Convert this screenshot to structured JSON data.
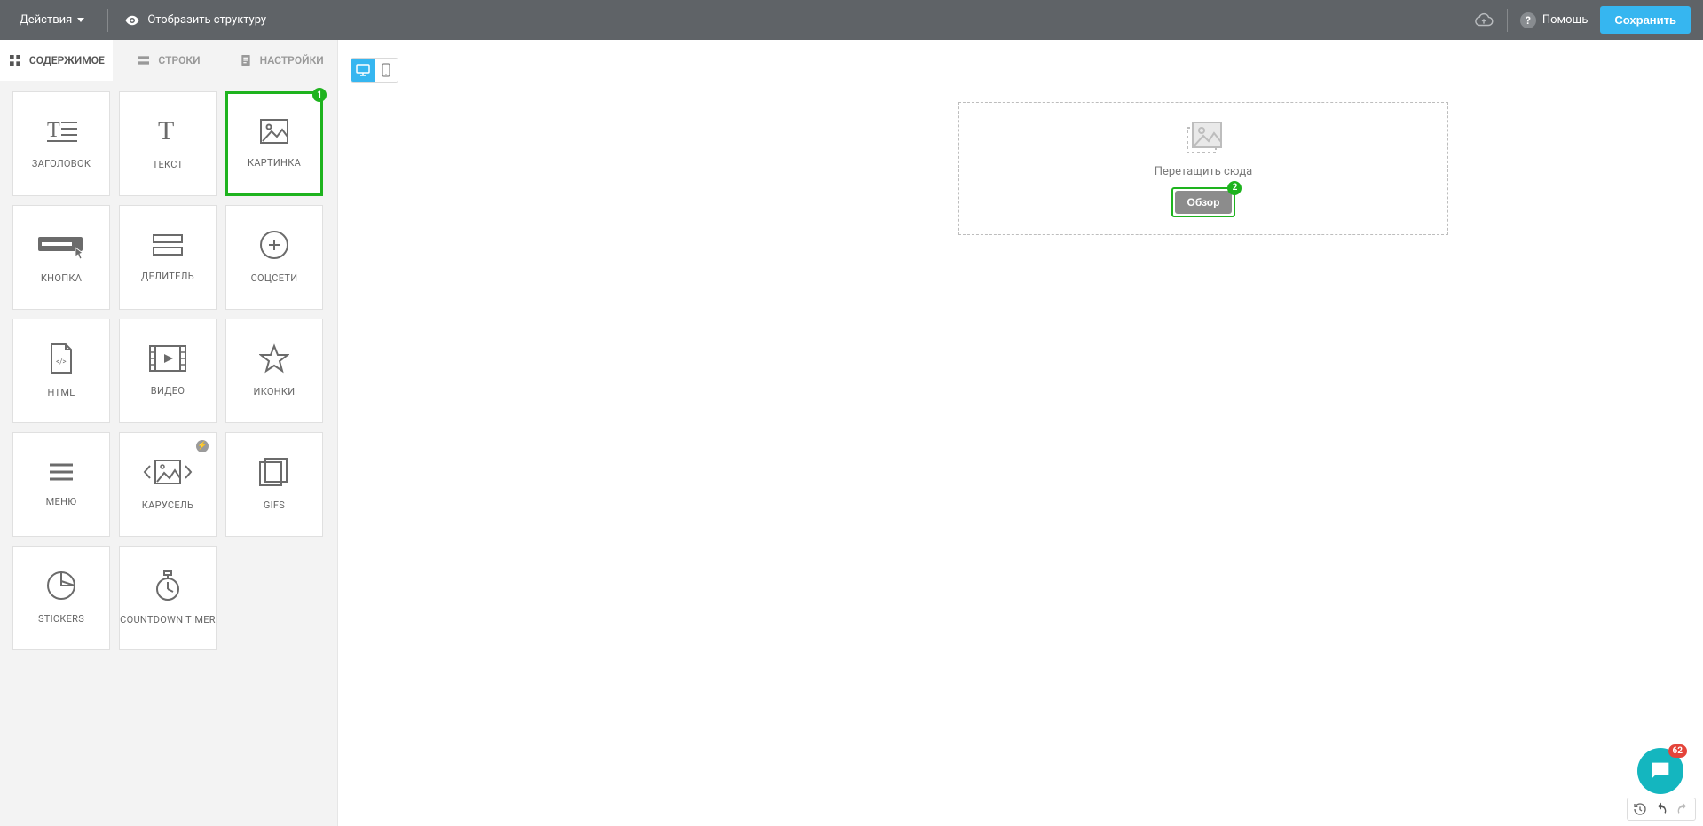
{
  "topbar": {
    "actions_label": "Действия",
    "show_structure_label": "Отобразить структуру",
    "help_label": "Помощь",
    "save_label": "Сохранить"
  },
  "tabs": {
    "content": "СОДЕРЖИМОЕ",
    "rows": "СТРОКИ",
    "settings": "НАСТРОЙКИ"
  },
  "tiles": [
    {
      "label": "ЗАГОЛОВОК",
      "icon": "heading",
      "highlighted": false
    },
    {
      "label": "ТЕКСТ",
      "icon": "text",
      "highlighted": false
    },
    {
      "label": "КАРТИНКА",
      "icon": "image",
      "highlighted": true,
      "step": "1"
    },
    {
      "label": "КНОПКА",
      "icon": "button",
      "highlighted": false
    },
    {
      "label": "ДЕЛИТЕЛЬ",
      "icon": "divider",
      "highlighted": false
    },
    {
      "label": "СОЦСЕТИ",
      "icon": "social",
      "highlighted": false
    },
    {
      "label": "HTML",
      "icon": "html",
      "highlighted": false
    },
    {
      "label": "ВИДЕО",
      "icon": "video",
      "highlighted": false
    },
    {
      "label": "ИКОНКИ",
      "icon": "star",
      "highlighted": false
    },
    {
      "label": "МЕНЮ",
      "icon": "menu",
      "highlighted": false
    },
    {
      "label": "КАРУСЕЛЬ",
      "icon": "carousel",
      "highlighted": false,
      "bolt": true
    },
    {
      "label": "GIFS",
      "icon": "gifs",
      "highlighted": false
    },
    {
      "label": "STICKERS",
      "icon": "sticker",
      "highlighted": false
    },
    {
      "label": "COUNTDOWN TIMER",
      "icon": "timer",
      "highlighted": false
    }
  ],
  "dropzone": {
    "drag_text": "Перетащить сюда",
    "browse_label": "Обзор",
    "step": "2"
  },
  "chat": {
    "count": "62"
  }
}
